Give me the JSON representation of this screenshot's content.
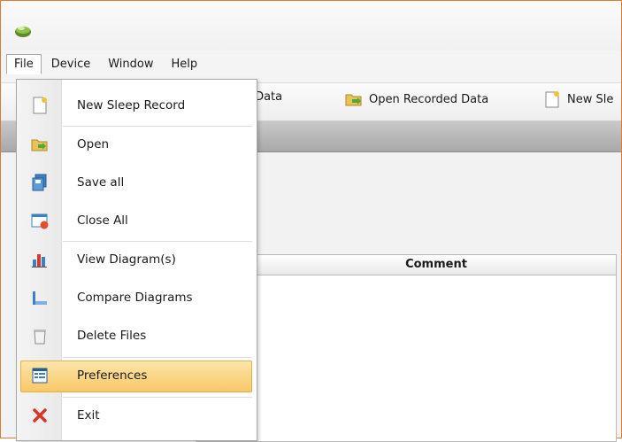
{
  "menubar": {
    "items": [
      "File",
      "Device",
      "Window",
      "Help"
    ]
  },
  "toolbar": {
    "items": [
      {
        "label": "ient Data",
        "icon": "document-icon"
      },
      {
        "label": "Open Recorded Data",
        "icon": "open-folder-icon"
      },
      {
        "label": "New Sle",
        "icon": "new-document-icon"
      }
    ]
  },
  "table": {
    "columns": [
      "",
      "Comment"
    ]
  },
  "file_menu": {
    "items": [
      {
        "label": "New Sleep Record",
        "icon": "new-document-icon"
      },
      {
        "label": "Open",
        "icon": "open-folder-icon"
      },
      {
        "label": "Save all",
        "icon": "save-icon"
      },
      {
        "label": "Close All",
        "icon": "close-all-icon"
      },
      {
        "label": "View Diagram(s)",
        "icon": "bar-chart-icon"
      },
      {
        "label": "Compare Diagrams",
        "icon": "compare-chart-icon"
      },
      {
        "label": "Delete Files",
        "icon": "trash-icon"
      },
      {
        "label": "Preferences",
        "icon": "preferences-icon",
        "highlighted": true
      },
      {
        "label": "Exit",
        "icon": "exit-icon"
      }
    ]
  },
  "colors": {
    "accent_border": "#e07a2e",
    "highlight": "#f8c867"
  }
}
